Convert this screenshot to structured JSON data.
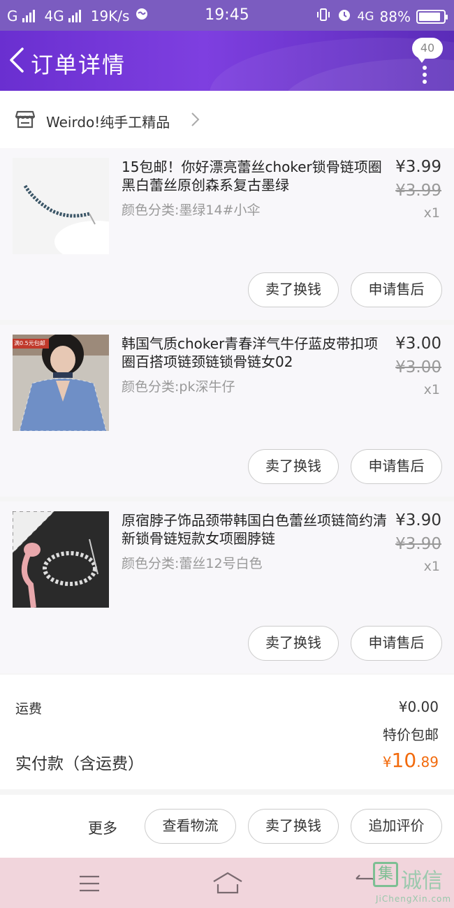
{
  "status_bar": {
    "carrier_left": "G",
    "network": "4G",
    "speed": "19K/s",
    "time": "19:45",
    "network_right": "4G",
    "battery": "88%",
    "battery_level": 0.88
  },
  "header": {
    "title": "订单详情",
    "badge_count": "40"
  },
  "shop": {
    "name": "Weirdo!纯手工精品"
  },
  "items": [
    {
      "title": "15包邮！你好漂亮蕾丝choker锁骨链项圈黑白蕾丝原创森系复古墨绿",
      "sku": "颜色分类:墨绿14#小伞",
      "price": "¥3.99",
      "original_price": "¥3.99",
      "quantity": "x1",
      "button_sell": "卖了换钱",
      "button_aftersale": "申请售后"
    },
    {
      "title": "韩国气质choker青春洋气牛仔蓝皮带扣项圈百搭项链颈链锁骨链女02",
      "sku": "颜色分类:pk深牛仔",
      "price": "¥3.00",
      "original_price": "¥3.00",
      "quantity": "x1",
      "button_sell": "卖了换钱",
      "button_aftersale": "申请售后",
      "thumb_tag": "满0.5元包邮"
    },
    {
      "title": "原宿脖子饰品颈带韩国白色蕾丝项链简约清新锁骨链短款女项圈脖链",
      "sku": "颜色分类:蕾丝12号白色",
      "price": "¥3.90",
      "original_price": "¥3.90",
      "quantity": "x1",
      "button_sell": "卖了换钱",
      "button_aftersale": "申请售后"
    }
  ],
  "summary": {
    "shipping_label": "运费",
    "shipping_value": "¥0.00",
    "promo": "特价包邮",
    "paid_label": "实付款（含运费）",
    "paid_currency": "¥",
    "paid_integer": "10",
    "paid_decimal": ".89"
  },
  "actions": {
    "more": "更多",
    "logistics": "查看物流",
    "sell": "卖了换钱",
    "review": "追加评价"
  },
  "watermark": {
    "logo": "集",
    "cn": "诚信",
    "en": "JiChengXin.com"
  },
  "colors": {
    "header_accent": "#7e3fe0",
    "price_accent": "#f26a0c",
    "nav_bg": "#f1d5dc"
  }
}
